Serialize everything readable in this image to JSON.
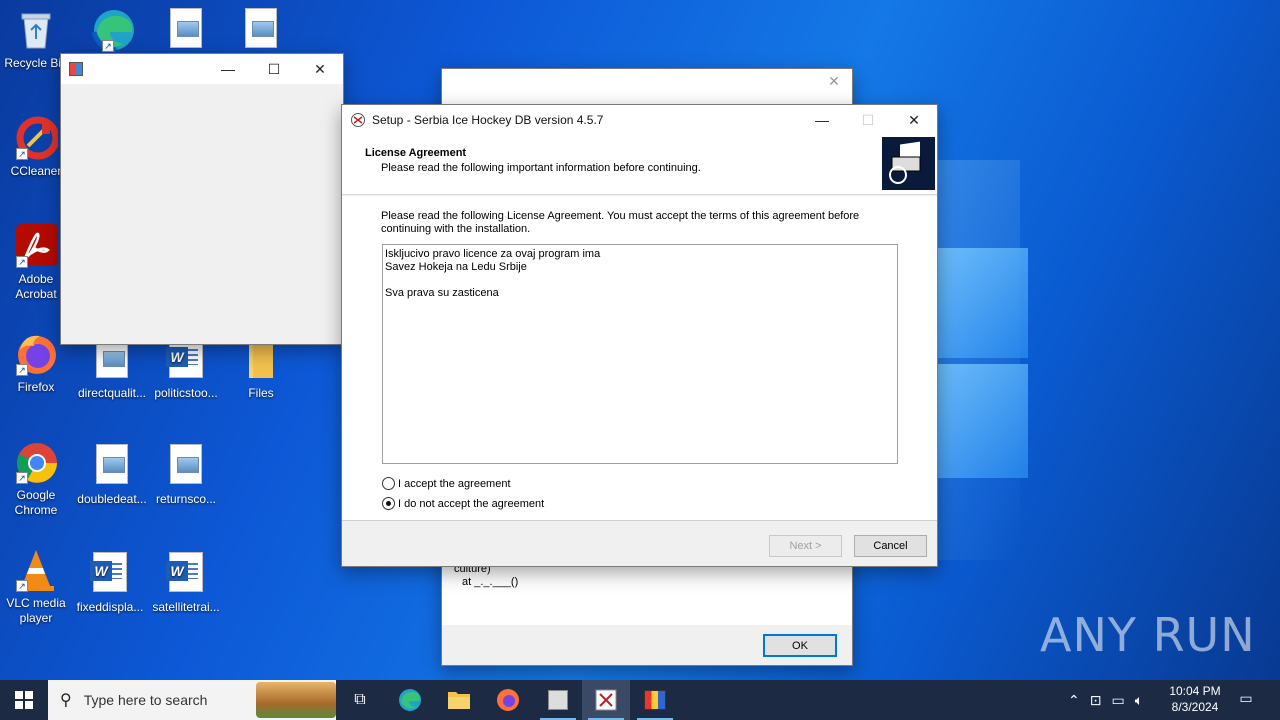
{
  "desktop": {
    "icons": [
      {
        "label": "Recycle Bin",
        "icon": "recycle-bin-icon"
      },
      {
        "label": "",
        "icon": "edge-icon"
      },
      {
        "label": "",
        "icon": "image-file-icon"
      },
      {
        "label": "",
        "icon": "image-file-icon"
      },
      {
        "label": "CCleaner",
        "icon": "ccleaner-icon"
      },
      {
        "label": "Adobe Acrobat",
        "icon": "acrobat-icon"
      },
      {
        "label": "Firefox",
        "icon": "firefox-icon"
      },
      {
        "label": "directqualit...",
        "icon": "image-file-icon"
      },
      {
        "label": "politicstoo...",
        "icon": "word-doc-icon"
      },
      {
        "label": "Files",
        "icon": "folder-icon"
      },
      {
        "label": "Google Chrome",
        "icon": "chrome-icon"
      },
      {
        "label": "doubledeat...",
        "icon": "image-file-icon"
      },
      {
        "label": "returnsco...",
        "icon": "image-file-icon"
      },
      {
        "label": "VLC media player",
        "icon": "vlc-icon"
      },
      {
        "label": "fixeddispla...",
        "icon": "word-doc-icon"
      },
      {
        "label": "satellitetrai...",
        "icon": "word-doc-icon"
      }
    ]
  },
  "back_dialog": {
    "code_lines": [
      "culture)",
      "at _._.___()"
    ],
    "ok_label": "OK"
  },
  "setup": {
    "title": "Setup - Serbia Ice Hockey DB version 4.5.7",
    "header_title": "License Agreement",
    "header_subtitle": "Please read the following important information before continuing.",
    "intro": "Please read the following License Agreement. You must accept the terms of this agreement before continuing with the installation.",
    "license_lines": [
      "Iskljucivo pravo licence za ovaj program ima",
      "Savez Hokeja na Ledu Srbije",
      "",
      "Sva prava su zasticena"
    ],
    "radio_accept": "I accept the agreement",
    "radio_decline": "I do not accept the agreement",
    "selected": "decline",
    "next_label": "Next >",
    "cancel_label": "Cancel"
  },
  "taskbar": {
    "search_placeholder": "Type here to search",
    "time": "10:04 PM",
    "date": "8/3/2024"
  },
  "watermark": "ANY RUN"
}
